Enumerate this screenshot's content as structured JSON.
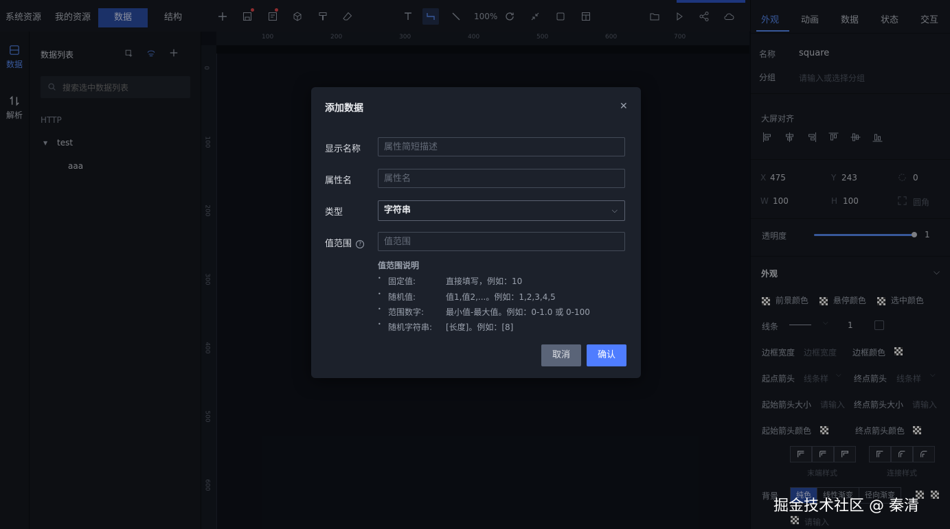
{
  "top_tabs": [
    {
      "label": "系统资源"
    },
    {
      "label": "我的资源"
    },
    {
      "label": "数据"
    },
    {
      "label": "结构"
    }
  ],
  "toolbar": {
    "zoom": "100%",
    "tools": [
      "plus-icon",
      "save-icon",
      "doc-icon",
      "cube-icon",
      "brush-icon",
      "eraser-icon",
      "text-icon",
      "connector-icon",
      "line-icon",
      "refresh-icon",
      "shrink-icon",
      "square-icon",
      "layout-icon",
      "folder-icon",
      "play-icon",
      "share-icon",
      "cloud-icon"
    ]
  },
  "rail": [
    {
      "label": "数据",
      "active": true
    },
    {
      "label": "解析",
      "active": false
    }
  ],
  "left_panel": {
    "title": "数据列表",
    "search_placeholder": "搜索选中数据列表",
    "group": "HTTP",
    "tree": [
      {
        "label": "test",
        "children": [
          {
            "label": "aaa"
          }
        ]
      }
    ]
  },
  "ruler": {
    "top": [
      "100",
      "200",
      "300",
      "400",
      "500",
      "600",
      "700"
    ],
    "left": [
      "0",
      "100",
      "200",
      "300",
      "400",
      "500",
      "600"
    ]
  },
  "right_panel": {
    "tabs": [
      "外观",
      "动画",
      "数据",
      "状态",
      "交互"
    ],
    "name_label": "名称",
    "name_value": "square",
    "group_label": "分组",
    "group_placeholder": "请输入或选择分组",
    "align_label": "大屏对齐",
    "x_label": "X",
    "x_value": "475",
    "y_label": "Y",
    "y_value": "243",
    "rotate_value": "0",
    "w_label": "W",
    "w_value": "100",
    "h_label": "H",
    "h_value": "100",
    "radius_label": "圆角",
    "opacity_label": "透明度",
    "opacity_value": "1",
    "opacity_level": 1,
    "appearance_label": "外观",
    "fg_color": "前景颜色",
    "hover_color": "悬停颜色",
    "selected_color": "选中颜色",
    "line_label": "线条",
    "line_width": "1",
    "border_width_label": "边框宽度",
    "border_width_placeholder": "边框宽度",
    "border_color_label": "边框颜色",
    "start_arrow_label": "起点箭头",
    "start_arrow_placeholder": "线条样",
    "end_arrow_label": "终点箭头",
    "end_arrow_placeholder": "线条样",
    "start_arrow_size_label": "起始箭头大小",
    "start_arrow_size_placeholder": "请输入",
    "end_arrow_size_label": "终点箭头大小",
    "end_arrow_size_placeholder": "请输入",
    "start_arrow_color_label": "起始箭头颜色",
    "end_arrow_color_label": "终点箭头颜色",
    "end_style_label": "末端样式",
    "join_style_label": "连接样式",
    "bg_label": "背景",
    "bg_options": [
      "纯色",
      "线性渐变",
      "径向渐变"
    ],
    "bg_placeholder": "请输入"
  },
  "modal": {
    "title": "添加数据",
    "fields": {
      "display_name_label": "显示名称",
      "display_name_placeholder": "属性简短描述",
      "prop_name_label": "属性名",
      "prop_name_placeholder": "属性名",
      "type_label": "类型",
      "type_value": "字符串",
      "range_label": "值范围",
      "range_placeholder": "值范围"
    },
    "notes_title": "值范围说明",
    "notes": [
      {
        "key": "固定值:",
        "desc": "直接填写，例如：10"
      },
      {
        "key": "随机值:",
        "desc": "值1,值2,...。例如：1,2,3,4,5"
      },
      {
        "key": "范围数字:",
        "desc": "最小值-最大值。例如：0-1.0 或 0-100"
      },
      {
        "key": "随机字符串:",
        "desc": "[长度]。例如：[8]"
      }
    ],
    "cancel_label": "取消",
    "confirm_label": "确认"
  },
  "watermark": "掘金技术社区 @ 秦清",
  "colors": {
    "accent": "#5b8ff9",
    "primary_button": "#4f7dff",
    "cancel_button": "#5a6478",
    "tab_active_bg": "#2c4fa8"
  }
}
